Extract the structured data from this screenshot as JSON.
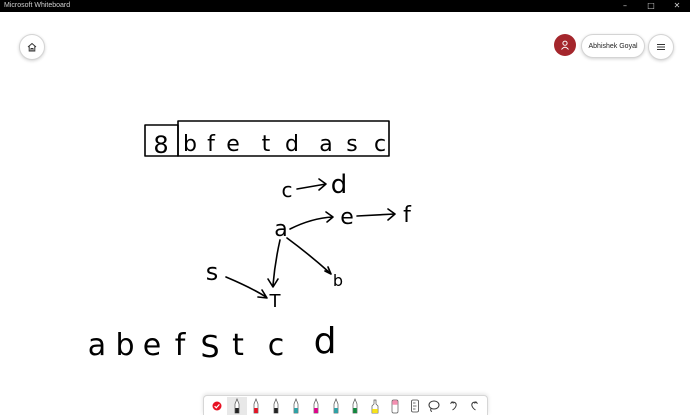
{
  "window": {
    "title": "Microsoft Whiteboard"
  },
  "user": {
    "name": "Abhishek Goyal"
  },
  "board": {
    "boxed_digit": "8",
    "queue": [
      "b",
      "f",
      "e",
      "t",
      "d",
      "a",
      "s",
      "c"
    ],
    "graph": {
      "nodes": [
        "c",
        "d",
        "a",
        "e",
        "f",
        "s",
        "T",
        "b"
      ],
      "edges": [
        [
          "c",
          "d"
        ],
        [
          "a",
          "e"
        ],
        [
          "e",
          "f"
        ],
        [
          "a",
          "T"
        ],
        [
          "a",
          "b"
        ],
        [
          "s",
          "T"
        ]
      ]
    },
    "result": [
      "a",
      "b",
      "e",
      "f",
      "S",
      "t",
      "c",
      "d"
    ]
  },
  "toolbar": {
    "tools": [
      "select-icon",
      "black-pen-icon",
      "red-pen-icon",
      "black-pen-icon",
      "teal-pen-icon",
      "pink-pen-icon",
      "teal-pen-icon",
      "green-pen-icon",
      "yellow-highlighter-icon",
      "pink-eraser-icon",
      "ruler-icon",
      "lasso-icon",
      "undo-icon",
      "redo-icon"
    ],
    "colors": {
      "red": "#e81123",
      "teal": "#2aa4a8",
      "pink": "#e3008c",
      "green": "#10893e",
      "yellow": "#f7e31a"
    }
  }
}
